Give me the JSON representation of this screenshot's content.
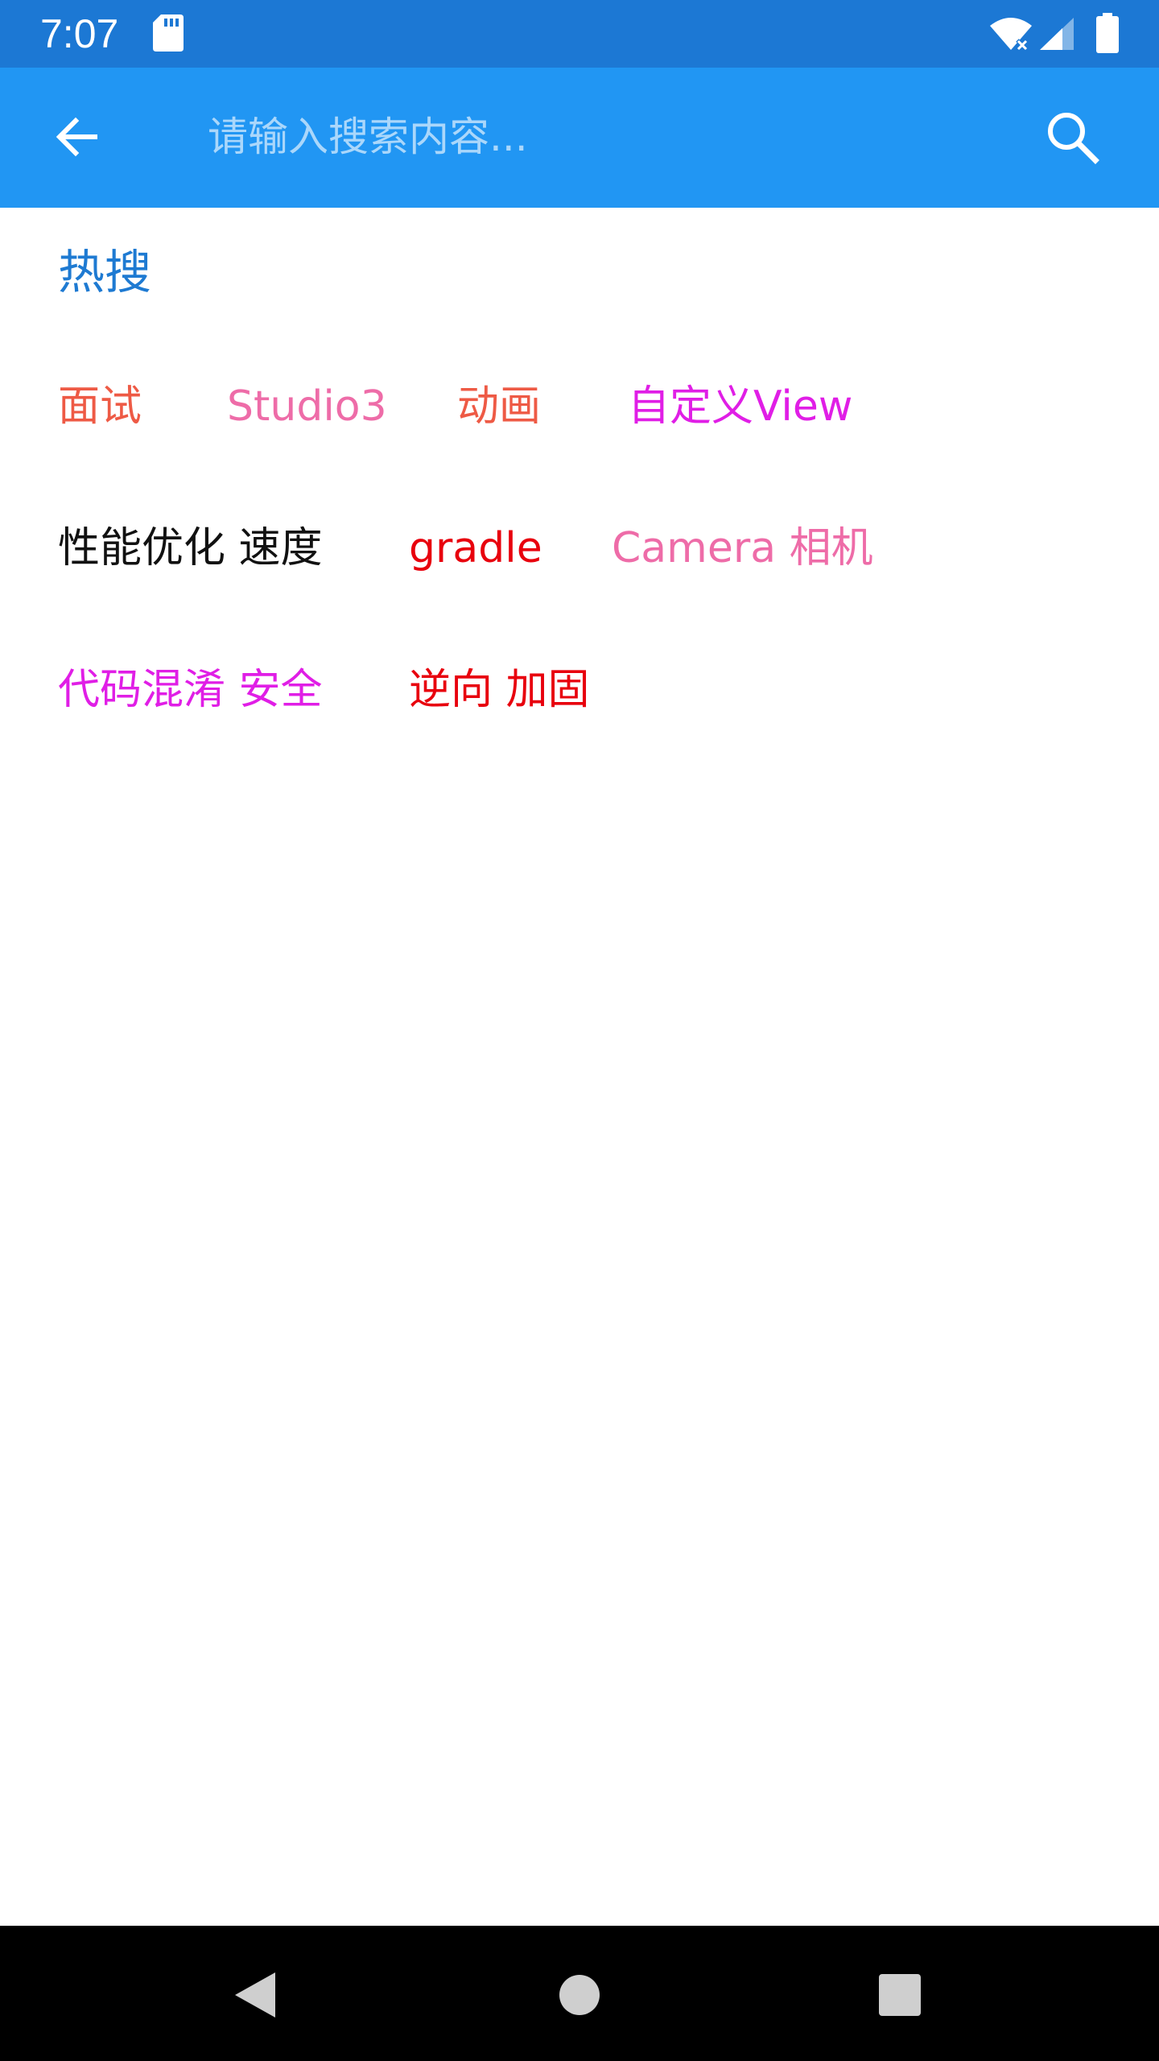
{
  "status_bar": {
    "time": "7:07",
    "icons": [
      "sd-card-icon",
      "wifi-icon",
      "signal-icon",
      "battery-icon"
    ]
  },
  "toolbar": {
    "back_icon": "arrow-left-icon",
    "search_placeholder": "请输入搜索内容...",
    "search_value": "",
    "search_icon": "search-icon"
  },
  "hot_search": {
    "title": "热搜",
    "tags": [
      {
        "label": "面试",
        "color": "#ee5a45"
      },
      {
        "label": "Studio3",
        "color": "#ee6ca8"
      },
      {
        "label": "动画",
        "color": "#ee5a45"
      },
      {
        "label": "自定义View",
        "color": "#e01ee6"
      },
      {
        "label": "性能优化 速度",
        "color": "#111111"
      },
      {
        "label": "gradle",
        "color": "#e8000d"
      },
      {
        "label": "Camera 相机",
        "color": "#ee6ca8"
      },
      {
        "label": "代码混淆 安全",
        "color": "#e01ee6"
      },
      {
        "label": "逆向 加固",
        "color": "#e8000d"
      }
    ]
  },
  "colors": {
    "status_bar": "#1c78d4",
    "toolbar": "#2196f3",
    "title_accent": "#1e7ad2",
    "nav_bar": "#000000"
  },
  "nav_bar": {
    "icons": [
      "nav-back-icon",
      "nav-home-icon",
      "nav-recents-icon"
    ]
  }
}
